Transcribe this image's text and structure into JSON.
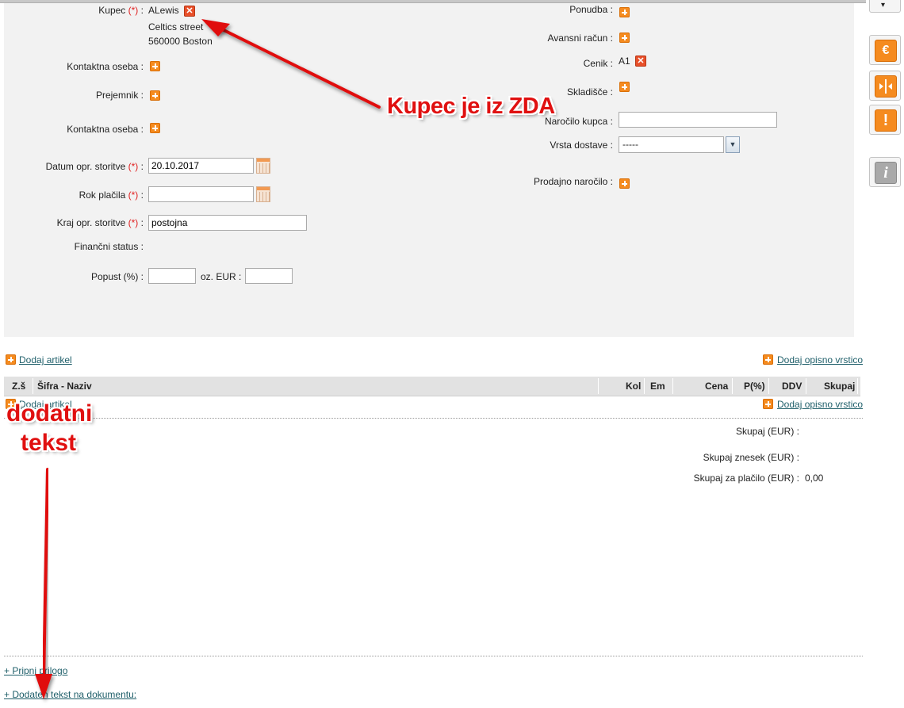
{
  "form": {
    "kupec_label": "Kupec",
    "required_mark": "(*)",
    "colon": ":",
    "kupec_name": "ALewis",
    "kupec_street": "Celtics street",
    "kupec_city": "560000 Boston",
    "kontaktna_oseba_label": "Kontaktna oseba :",
    "prejemnik_label": "Prejemnik :",
    "kontaktna_oseba2_label": "Kontaktna oseba :",
    "datum_label": "Datum opr. storitve",
    "datum_value": "20.10.2017",
    "rok_label": "Rok plačila",
    "rok_value": "",
    "kraj_label": "Kraj opr. storitve",
    "kraj_value": "postojna",
    "financni_label": "Finančni status :",
    "popust_label": "Popust (%) :",
    "popust_value": "",
    "oz_eur_label": "oz. EUR :",
    "oz_eur_value": "",
    "ponudba_label": "Ponudba :",
    "avansni_label": "Avansni račun :",
    "cenik_label": "Cenik :",
    "cenik_value": "A1",
    "skladisce_label": "Skladišče :",
    "narocilo_label": "Naročilo kupca :",
    "narocilo_value": "",
    "vrsta_label": "Vrsta dostave :",
    "vrsta_value": "-----",
    "prodajno_label": "Prodajno naročilo :"
  },
  "items": {
    "add_article": "Dodaj artikel",
    "add_desc_row": "Dodaj opisno vrstico",
    "columns": [
      "Z.š",
      "Šifra - Naziv",
      "Kol",
      "Em",
      "Cena",
      "P(%)",
      "DDV",
      "Skupaj"
    ],
    "add_article_2": "Dodaj artikel",
    "add_desc_row_2": "Dodaj opisno vrstico"
  },
  "totals": {
    "skupaj_label": "Skupaj (EUR) :",
    "skupaj_znesek_label": "Skupaj znesek (EUR) :",
    "skupaj_placilo_label": "Skupaj za plačilo (EUR) :",
    "skupaj_placilo_value": "0,00"
  },
  "footer": {
    "attach_link": "+ Pripni prilogo",
    "added_text_link": "+ Dodaten tekst na dokumentu:"
  },
  "annotations": {
    "kupec_note": "Kupec je iz ZDA",
    "text_note_line1": "dodatni",
    "text_note_line2": "tekst"
  },
  "sidebar": {
    "euro_icon": "€",
    "warning_icon": "!",
    "info_icon": "i",
    "dropdown_icon": "▾"
  },
  "colors": {
    "orange": "#f58b1f",
    "annotation_red": "#e01010",
    "link": "#1f5f6a"
  }
}
